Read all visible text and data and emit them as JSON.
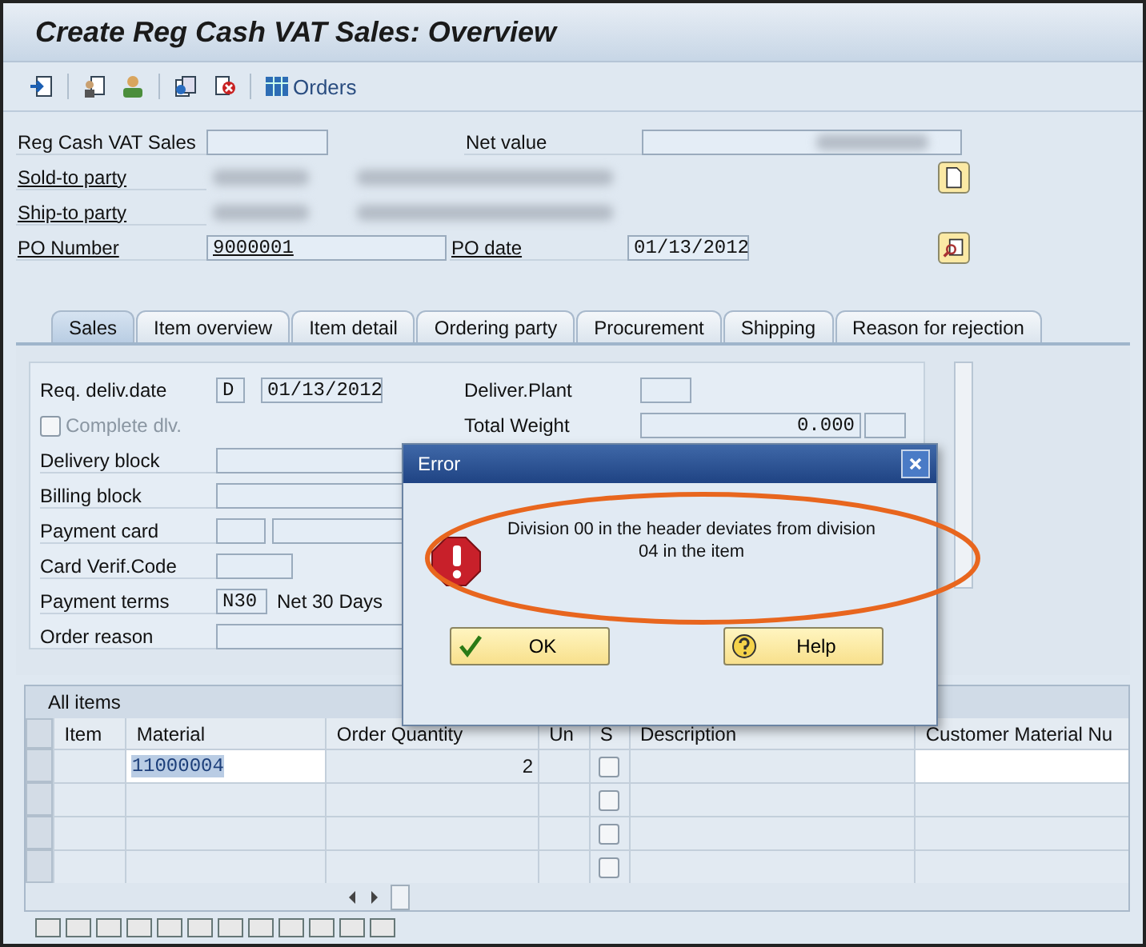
{
  "title": "Create Reg Cash VAT Sales: Overview",
  "toolbar": {
    "orders_label": "Orders"
  },
  "header": {
    "doc_label": "Reg Cash VAT Sales",
    "net_value_label": "Net value",
    "sold_to_label": "Sold-to party",
    "ship_to_label": "Ship-to party",
    "po_number_label": "PO Number",
    "po_number": "9000001",
    "po_date_label": "PO date",
    "po_date": "01/13/2012"
  },
  "tabs": [
    {
      "label": "Sales",
      "selected": true
    },
    {
      "label": "Item overview",
      "selected": false
    },
    {
      "label": "Item detail",
      "selected": false
    },
    {
      "label": "Ordering party",
      "selected": false
    },
    {
      "label": "Procurement",
      "selected": false
    },
    {
      "label": "Shipping",
      "selected": false
    },
    {
      "label": "Reason for rejection",
      "selected": false
    }
  ],
  "sales": {
    "req_deliv_label": "Req. deliv.date",
    "req_deliv_type": "D",
    "req_deliv_date": "01/13/2012",
    "complete_dlv": {
      "label": "Complete dlv.",
      "checked": false,
      "disabled": true
    },
    "fields": [
      {
        "label": "Delivery block",
        "kind": "wide"
      },
      {
        "label": "Billing block",
        "kind": "wide"
      },
      {
        "label": "Payment card",
        "kind": "split"
      },
      {
        "label": "Card Verif.Code",
        "kind": "short"
      },
      {
        "label": "Payment terms",
        "kind": "code",
        "value": "N30",
        "text": "Net 30 Days"
      },
      {
        "label": "Order reason",
        "kind": "wide"
      }
    ],
    "deliver_plant_label": "Deliver.Plant",
    "total_weight_label": "Total Weight",
    "total_weight": "0.000"
  },
  "items": {
    "title": "All items",
    "columns": [
      "Item",
      "Material",
      "Order Quantity",
      "Un",
      "S",
      "Description",
      "Customer Material Nu"
    ],
    "rows": [
      {
        "material": "11000004",
        "quantity": "2",
        "checked": false
      },
      {
        "checked": false
      },
      {
        "checked": false
      },
      {
        "checked": false
      }
    ]
  },
  "dialog": {
    "title": "Error",
    "message": "Division 00 in the header deviates from division 04 in the item",
    "buttons": [
      {
        "label": "OK",
        "kind": "ok"
      },
      {
        "label": "Help",
        "kind": "help"
      }
    ]
  }
}
